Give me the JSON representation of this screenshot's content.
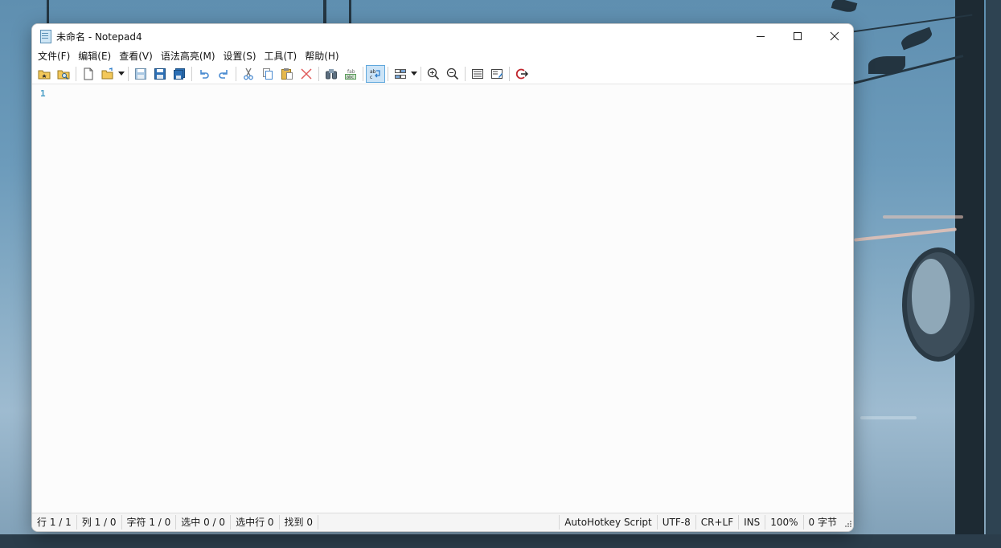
{
  "window": {
    "title": "未命名 - Notepad4",
    "controls": {
      "minimize": "─",
      "maximize": "☐",
      "close": "✕"
    }
  },
  "menu": {
    "items": [
      "文件(F)",
      "编辑(E)",
      "查看(V)",
      "语法高亮(M)",
      "设置(S)",
      "工具(T)",
      "帮助(H)"
    ]
  },
  "toolbar": {
    "buttons": [
      "browse-folder-icon",
      "find-file-icon",
      "new-file-icon",
      "open-file-icon",
      "save-icon",
      "save-as-icon",
      "save-copy-icon",
      "undo-icon",
      "redo-icon",
      "cut-icon",
      "copy-icon",
      "paste-icon",
      "delete-icon",
      "find-icon",
      "replace-icon",
      "word-wrap-icon",
      "scheme-icon",
      "zoom-in-icon",
      "zoom-out-icon",
      "view-icon",
      "settings-icon",
      "exit-icon"
    ],
    "active": "word-wrap-icon",
    "accent": "#5fa7dc"
  },
  "editor": {
    "line_number": "1"
  },
  "status": {
    "line": "行 1 / 1",
    "column": "列 1 / 0",
    "char": "字符 1 / 0",
    "selection": "选中 0 / 0",
    "selected_lines": "选中行 0",
    "found": "找到 0",
    "scheme": "AutoHotkey Script",
    "encoding": "UTF-8",
    "eol": "CR+LF",
    "mode": "INS",
    "zoom": "100%",
    "size": "0 字节"
  },
  "colors": {
    "line_number": "#4a9ec6",
    "close_hover": "#c42b1c"
  }
}
